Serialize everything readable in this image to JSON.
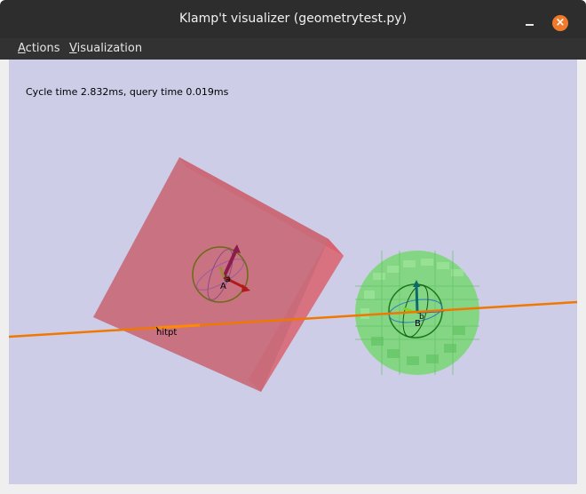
{
  "window": {
    "title": "Klamp't visualizer (geometrytest.py)",
    "close_glyph": "×"
  },
  "menu": {
    "actions": {
      "mnemonic": "A",
      "rest": "ctions"
    },
    "visualization": {
      "mnemonic": "V",
      "rest": "isualization"
    }
  },
  "viewport": {
    "background": "#cdcde8",
    "status_text": "Cycle time 2.832ms, query time 0.019ms",
    "labels": {
      "hit_point": "hitpt",
      "frame_a": "A",
      "frame_b": "B",
      "point_a": "a",
      "point_b": "b"
    }
  },
  "colors": {
    "box": "#c96a78",
    "sphere": "#7fd67f",
    "ray": "#f07800",
    "close_button": "#f07a2c"
  },
  "icons": {
    "minimize": "minimize-icon",
    "close": "close-icon"
  }
}
